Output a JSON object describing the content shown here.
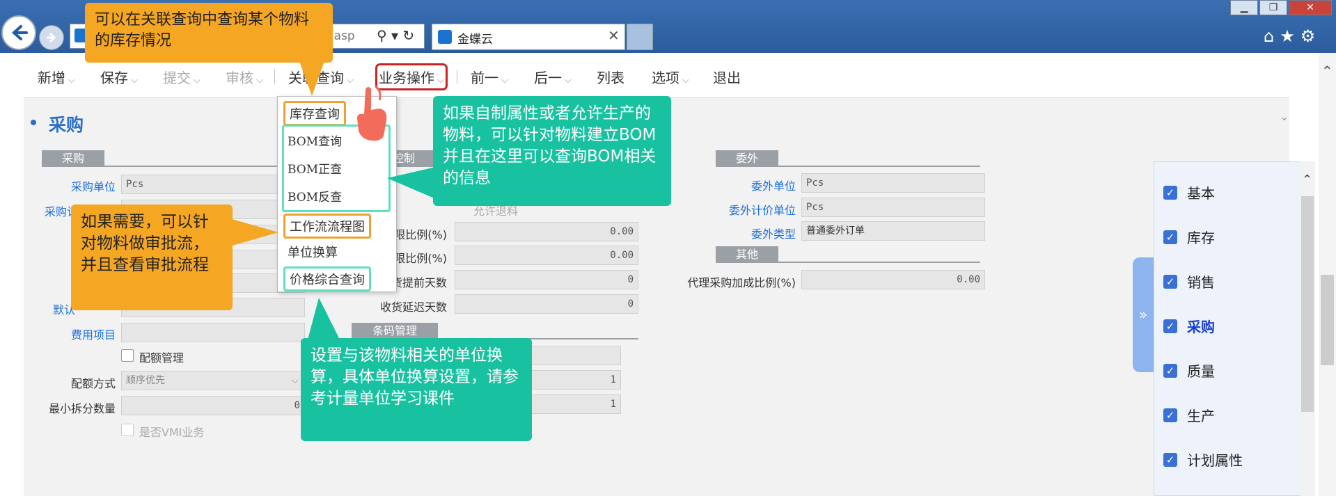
{
  "browser": {
    "address_text": "rm.asp",
    "address_tools": "⚲ ▾ ↻",
    "tab_title": "金蝶云",
    "tab_close": "✕",
    "win_min": "▁",
    "win_max": "❐",
    "win_close": "✕",
    "ie_icons": "⌂★⚙"
  },
  "toolbar": {
    "new": "新增",
    "save": "保存",
    "submit": "提交",
    "audit": "审核",
    "related_query": "关联查询",
    "business_ops": "业务操作",
    "prev": "前一",
    "next": "后一",
    "list": "列表",
    "options": "选项",
    "exit": "退出",
    "chevron": "⌵"
  },
  "dropdown": {
    "inventory_query": "库存查询",
    "bom_query": "BOM查询",
    "bom_forward": "BOM正查",
    "bom_reverse": "BOM反查",
    "workflow_chart": "工作流流程图",
    "unit_conversion": "单位换算",
    "price_query": "价格综合查询"
  },
  "section": {
    "title": "采购",
    "collapse_chevron": "⌄"
  },
  "purchase": {
    "header": "采购",
    "unit_label": "采购单位",
    "unit_value": "Pcs",
    "pricing_label": "采购计",
    "default_label": "默认",
    "expense_label": "费用项目",
    "quota_mgmt": "配额管理",
    "quota_method_label": "配额方式",
    "quota_method_value": "顺序优先",
    "min_split_label": "最小拆分数量",
    "min_split_value": "0",
    "vmi_label": "是否VMI业务"
  },
  "control": {
    "header": "控制",
    "allow_return": "允许退料",
    "upper_ratio_label": "限比例(%)",
    "upper_ratio_value": "0.00",
    "lower_ratio_label": "限比例(%)",
    "lower_ratio_value": "0.00",
    "advance_days_label": "货提前天数",
    "advance_days_value": "0",
    "delay_days_label": "收货延迟天数",
    "delay_days_value": "0",
    "barcode_header": "条码管理",
    "barcode_value1": "1",
    "barcode_value2": "1"
  },
  "outsource": {
    "header": "委外",
    "unit_label": "委外单位",
    "unit_value": "Pcs",
    "price_unit_label": "委外计价单位",
    "price_unit_value": "Pcs",
    "type_label": "委外类型",
    "type_value": "普通委外订单"
  },
  "other": {
    "header": "其他",
    "agent_markup_label": "代理采购加成比例(%)",
    "agent_markup_value": "0.00"
  },
  "right_panel": {
    "expander": "»",
    "scroll_up": "⌃",
    "items": [
      {
        "label": "基本",
        "checked": true
      },
      {
        "label": "库存",
        "checked": true
      },
      {
        "label": "销售",
        "checked": true
      },
      {
        "label": "采购",
        "checked": true
      },
      {
        "label": "质量",
        "checked": true
      },
      {
        "label": "生产",
        "checked": true
      },
      {
        "label": "计划属性",
        "checked": true
      }
    ],
    "check_glyph": "✓"
  },
  "callouts": {
    "related_query": "可以在关联查询中查询某个物料的库存情况",
    "bom": "如果自制属性或者允许生产的物料，可以针对物料建立BOM并且在这里可以查询BOM相关的信息",
    "workflow": "如果需要，可以针对物料做审批流，并且查看审批流程",
    "unit": "设置与该物料相关的单位换算，具体单位换算设置，请参考计量单位学习课件"
  },
  "colors": {
    "callout_orange": "#f5a623",
    "callout_teal": "#18c2a0",
    "highlight_red": "#cc2222",
    "link_blue": "#1d6fe0"
  }
}
